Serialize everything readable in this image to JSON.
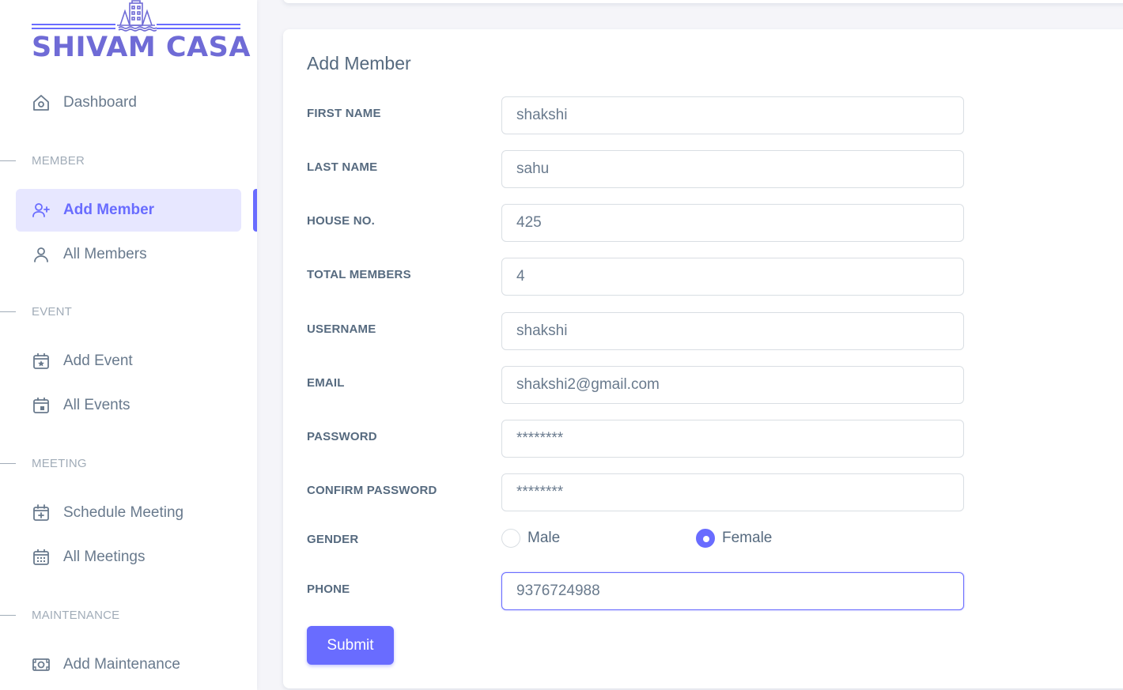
{
  "brand": {
    "name": "SHIVAM CASA"
  },
  "sidebar": {
    "dashboard": {
      "label": "Dashboard",
      "icon": "home-icon"
    },
    "sections": [
      {
        "header": "MEMBER",
        "items": [
          {
            "label": "Add Member",
            "icon": "user-plus-icon",
            "active": true
          },
          {
            "label": "All Members",
            "icon": "user-icon"
          }
        ]
      },
      {
        "header": "EVENT",
        "items": [
          {
            "label": "Add Event",
            "icon": "calendar-star-icon"
          },
          {
            "label": "All Events",
            "icon": "calendar-icon"
          }
        ]
      },
      {
        "header": "MEETING",
        "items": [
          {
            "label": "Schedule Meeting",
            "icon": "calendar-plus-icon"
          },
          {
            "label": "All Meetings",
            "icon": "calendar-grid-icon"
          }
        ]
      },
      {
        "header": "MAINTENANCE",
        "items": [
          {
            "label": "Add Maintenance",
            "icon": "money-icon"
          }
        ]
      }
    ]
  },
  "form": {
    "title": "Add Member",
    "fields": {
      "first_name": {
        "label": "FIRST NAME",
        "value": "shakshi"
      },
      "last_name": {
        "label": "LAST NAME",
        "value": "sahu"
      },
      "house_no": {
        "label": "HOUSE NO.",
        "value": "425"
      },
      "total_members": {
        "label": "TOTAL MEMBERS",
        "value": "4"
      },
      "username": {
        "label": "USERNAME",
        "value": "shakshi"
      },
      "email": {
        "label": "EMAIL",
        "value": "shakshi2@gmail.com"
      },
      "password": {
        "label": "PASSWORD",
        "value": "********"
      },
      "confirm_password": {
        "label": "CONFIRM PASSWORD",
        "value": "********"
      },
      "phone": {
        "label": "PHONE",
        "value": "9376724988"
      }
    },
    "gender": {
      "label": "GENDER",
      "options": [
        "Male",
        "Female"
      ],
      "selected": "Female"
    },
    "submit_label": "Submit"
  },
  "colors": {
    "accent": "#696cff",
    "accent_light": "#e7e7ff",
    "brand": "#6f6bd6",
    "text": "#566a7f",
    "muted": "#a1acb8"
  }
}
